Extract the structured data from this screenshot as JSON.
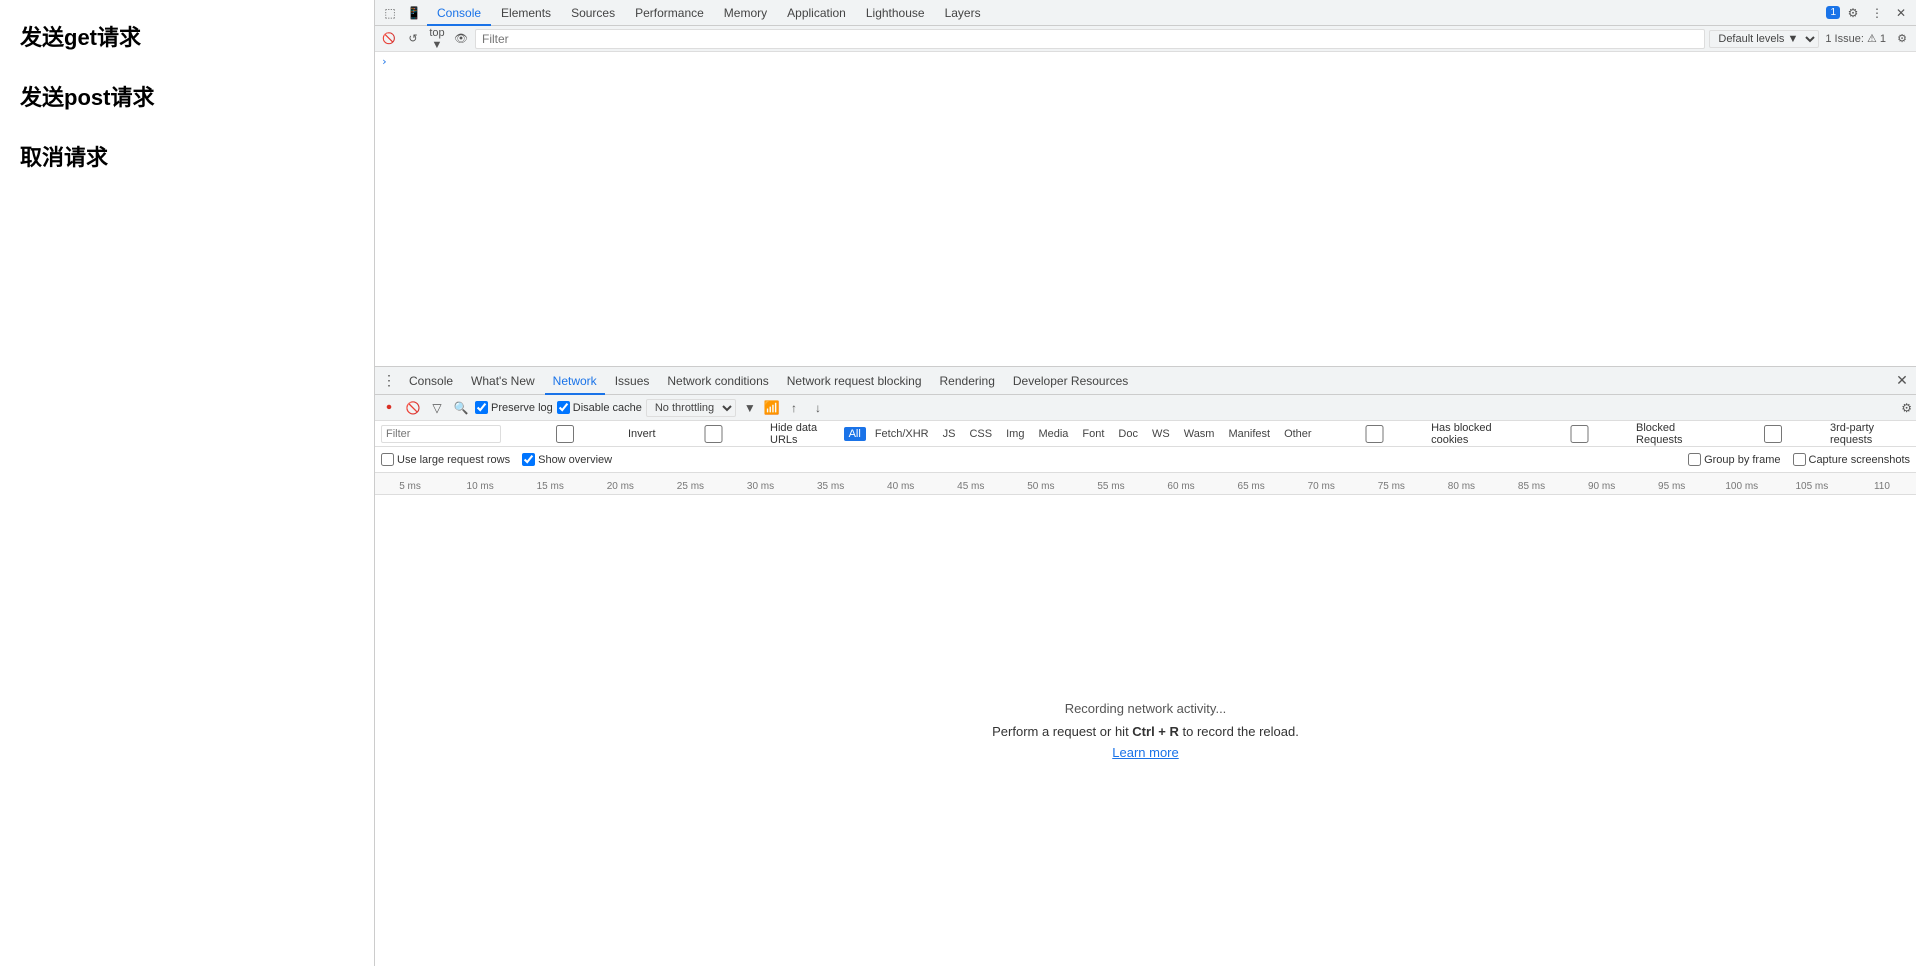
{
  "page": {
    "links": [
      {
        "label": "发送get请求"
      },
      {
        "label": "发送post请求"
      },
      {
        "label": "取消请求"
      }
    ]
  },
  "devtools": {
    "top_tabs": [
      {
        "label": "Console",
        "active": true
      },
      {
        "label": "Elements"
      },
      {
        "label": "Sources"
      },
      {
        "label": "Performance"
      },
      {
        "label": "Memory"
      },
      {
        "label": "Application"
      },
      {
        "label": "Lighthouse"
      },
      {
        "label": "Layers"
      }
    ],
    "filter_placeholder": "Filter",
    "default_levels": "Default levels ▼",
    "issue_badge": "1 Issue: ⚠ 1",
    "console_arrow": "›",
    "network": {
      "tabs": [
        {
          "label": "⋮",
          "dots": true
        },
        {
          "label": "Console"
        },
        {
          "label": "What's New"
        },
        {
          "label": "Network",
          "active": true
        },
        {
          "label": "Issues"
        },
        {
          "label": "Network conditions"
        },
        {
          "label": "Network request blocking"
        },
        {
          "label": "Rendering"
        },
        {
          "label": "Developer Resources"
        }
      ],
      "toolbar": {
        "preserve_log": "Preserve log",
        "disable_cache": "Disable cache",
        "throttling": "No throttling"
      },
      "filter": {
        "placeholder": "Filter",
        "invert": "Invert",
        "hide_data_urls": "Hide data URLs",
        "chips": [
          "All",
          "Fetch/XHR",
          "JS",
          "CSS",
          "Img",
          "Media",
          "Font",
          "Doc",
          "WS",
          "Wasm",
          "Manifest",
          "Other"
        ],
        "active_chip": "All",
        "has_blocked": "Has blocked cookies",
        "blocked_requests": "Blocked Requests",
        "third_party": "3rd-party requests"
      },
      "options": {
        "use_large_rows": "Use large request rows",
        "show_overview": "Show overview",
        "group_by_frame": "Group by frame",
        "capture_screenshots": "Capture screenshots"
      },
      "timeline": {
        "ticks": [
          "5 ms",
          "10 ms",
          "15 ms",
          "20 ms",
          "25 ms",
          "30 ms",
          "35 ms",
          "40 ms",
          "45 ms",
          "50 ms",
          "55 ms",
          "60 ms",
          "65 ms",
          "70 ms",
          "75 ms",
          "80 ms",
          "85 ms",
          "90 ms",
          "95 ms",
          "100 ms",
          "105 ms",
          "110"
        ]
      },
      "content": {
        "recording_text": "Recording network activity...",
        "record_hint": "Perform a request or hit Ctrl + R to record the reload.",
        "learn_more": "Learn more"
      }
    }
  }
}
